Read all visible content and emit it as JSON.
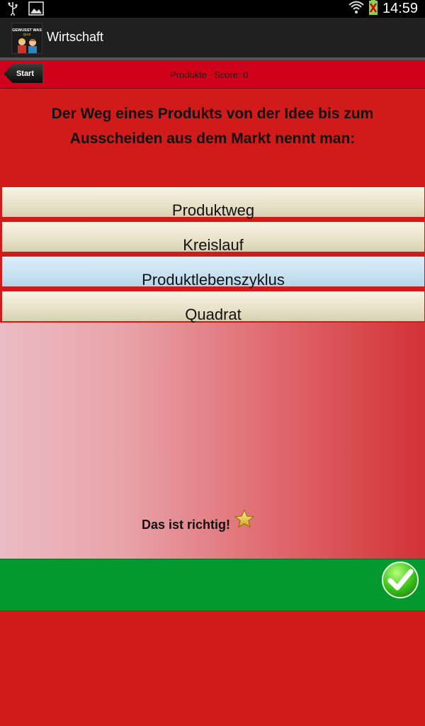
{
  "status_bar": {
    "time": "14:59",
    "icons_left": [
      "usb-icon",
      "image-icon"
    ],
    "icons_right": [
      "wifi-icon",
      "battery-icon"
    ]
  },
  "app": {
    "title": "Wirtschaft",
    "icon_texts": [
      "GEWUSST WAS",
      "QUIZ"
    ]
  },
  "toolbar": {
    "back_label": "Start",
    "category": "Produkte",
    "score_label": "Score: 0"
  },
  "question": "Der Weg eines Produkts von der Idee bis zum Ausscheiden aus dem Markt nennt man:",
  "answers": [
    {
      "label": "Produktweg",
      "selected": false
    },
    {
      "label": "Kreislauf",
      "selected": false
    },
    {
      "label": "Produktlebenszyklus",
      "selected": true
    },
    {
      "label": "Quadrat",
      "selected": false
    }
  ],
  "feedback": {
    "text": "Das ist richtig!",
    "icon": "star-icon"
  },
  "next_button": {
    "icon": "checkmark-icon"
  },
  "colors": {
    "background_red": "#d11a1a",
    "toolbar_red": "#d0021b",
    "selected_blue": "#c7e1f0",
    "confirm_green": "#04992f"
  }
}
